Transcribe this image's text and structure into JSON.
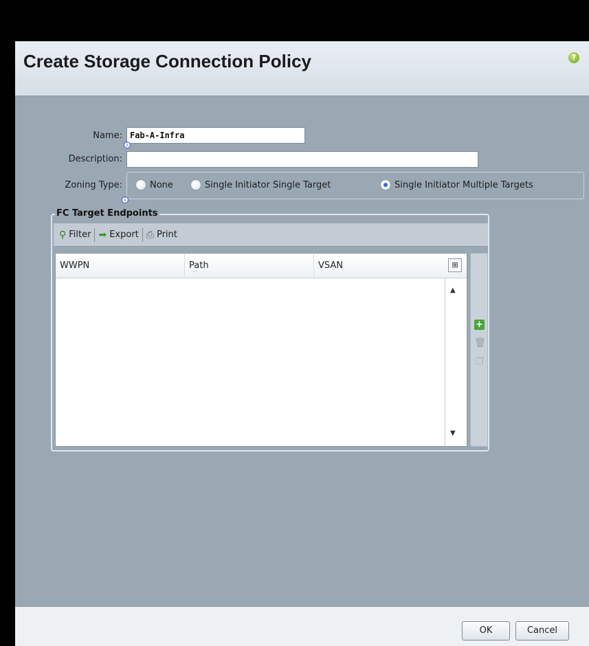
{
  "dialog": {
    "title": "Create Storage Connection Policy",
    "help_icon": "help-icon"
  },
  "form": {
    "name_label": "Name:",
    "name_value": "Fab-A-Infra",
    "description_label": "Description:",
    "description_value": "",
    "zoning_label": "Zoning Type:",
    "zoning_options": [
      {
        "label": "None",
        "selected": false
      },
      {
        "label": "Single Initiator Single Target",
        "selected": false
      },
      {
        "label": "Single Initiator Multiple Targets",
        "selected": true
      }
    ]
  },
  "fc_targets": {
    "legend": "FC Target Endpoints",
    "toolbar": {
      "filter_label": "Filter",
      "export_label": "Export",
      "print_label": "Print"
    },
    "columns": [
      "WWPN",
      "Path",
      "VSAN"
    ],
    "rows": []
  },
  "footer": {
    "ok_label": "OK",
    "cancel_label": "Cancel"
  }
}
